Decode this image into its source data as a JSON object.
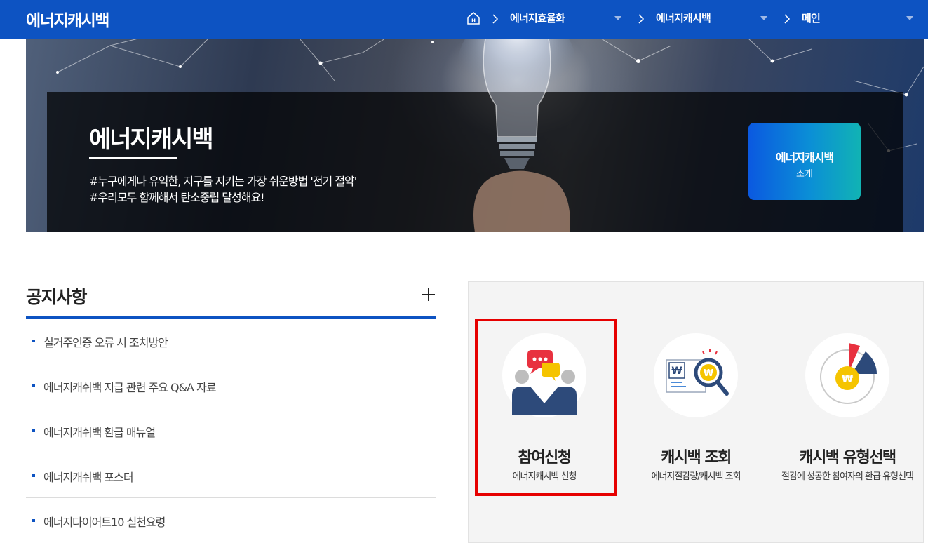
{
  "header": {
    "brand": "에너지캐시백",
    "breadcrumb": [
      {
        "label": "에너지효율화"
      },
      {
        "label": "에너지캐시백"
      },
      {
        "label": "메인"
      }
    ]
  },
  "banner": {
    "title": "에너지캐시백",
    "line1": "#누구에게나 유익한, 지구를 지키는 가장 쉬운방법 '전기 절약'",
    "line2": "#우리모두 함께해서 탄소중립 달성해요!",
    "intro_button": {
      "line1": "에너지캐시백",
      "line2": "소개"
    }
  },
  "notice": {
    "title": "공지사항",
    "items": [
      {
        "label": "실거주인증 오류 시 조치방안"
      },
      {
        "label": "에너지캐쉬백 지급 관련 주요 Q&A 자료"
      },
      {
        "label": "에너지캐쉬백 환급 매뉴얼"
      },
      {
        "label": "에너지캐쉬백 포스터"
      },
      {
        "label": "에너지다이어트10 실천요령"
      }
    ]
  },
  "quick": [
    {
      "title": "참여신청",
      "sub": "에너지캐시백 신청"
    },
    {
      "title": "캐시백 조회",
      "sub": "에너지절감량/캐시백 조회"
    },
    {
      "title": "캐시백 유형선택",
      "sub": "절감에 성공한 참여자의 환급 유형선택"
    }
  ],
  "colors": {
    "header_bg": "#0d53c2",
    "accent": "#0d53c2",
    "highlight": "#e60000",
    "coin": "#f5c400",
    "navy": "#2d4a7a",
    "red": "#e8313f"
  },
  "icons": {
    "home": "home-icon",
    "breadcrumb_separator": "chevron-right-icon",
    "dropdown": "caret-down-icon",
    "more": "plus-icon",
    "apply": "chat-people-icon",
    "lookup": "magnifier-document-icon",
    "select_type": "pie-coin-icon"
  }
}
